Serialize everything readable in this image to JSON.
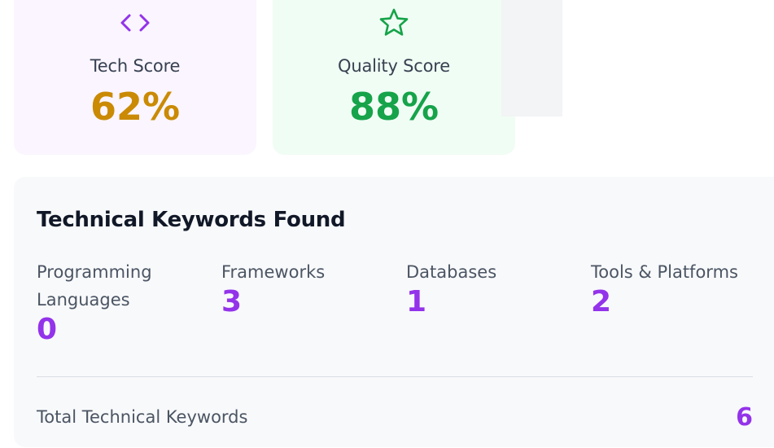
{
  "scores": [
    {
      "label": "Tech Score",
      "value": "62%",
      "icon": "code-icon",
      "icon_color": "#9333ea",
      "value_color": "#ca8a04",
      "background": "#faf5ff"
    },
    {
      "label": "Quality Score",
      "value": "88%",
      "icon": "star-icon",
      "icon_color": "#16a34a",
      "value_color": "#16a34a",
      "background": "#f0fdf4"
    }
  ],
  "keywords": {
    "title": "Technical Keywords Found",
    "categories": [
      {
        "label": "Programming Languages",
        "count": "0"
      },
      {
        "label": "Frameworks",
        "count": "3"
      },
      {
        "label": "Databases",
        "count": "1"
      },
      {
        "label": "Tools & Platforms",
        "count": "2"
      }
    ],
    "total_label": "Total Technical Keywords",
    "total_value": "6",
    "accent_color": "#9333ea"
  }
}
